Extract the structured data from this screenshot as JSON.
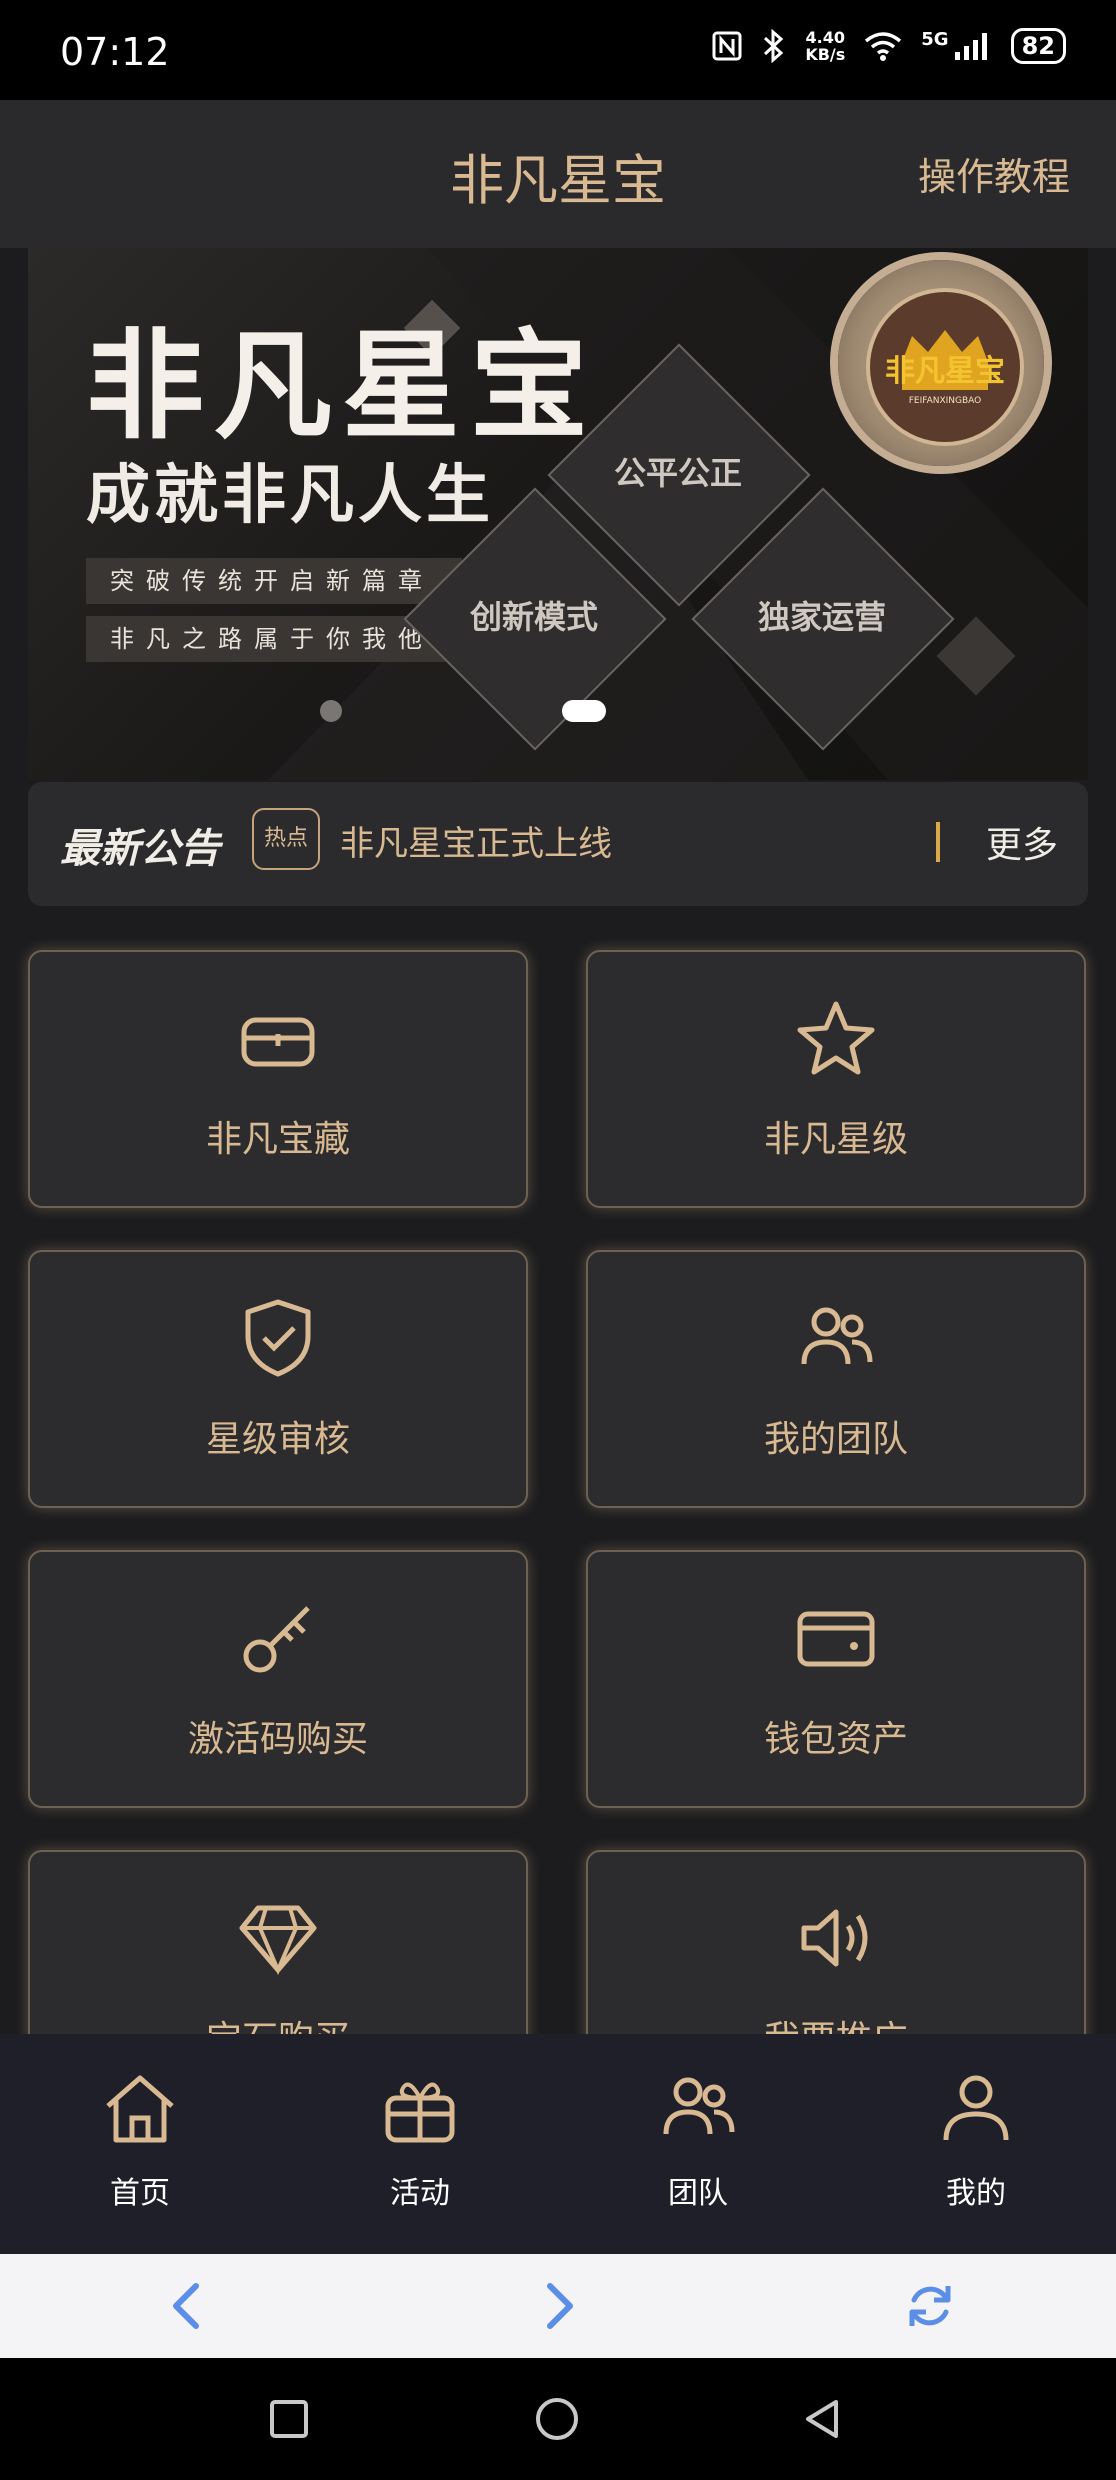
{
  "status_bar": {
    "time": "07:12",
    "net_speed_value": "4.40",
    "net_speed_unit": "KB/s",
    "network": "5G",
    "battery": "82"
  },
  "header": {
    "title": "非凡星宝",
    "tutorial_label": "操作教程"
  },
  "banner": {
    "title": "非凡星宝",
    "subtitle": "成就非凡人生",
    "tags": [
      "突破传统开启新篇章",
      "非凡之路属于你我他"
    ],
    "diamonds": [
      "公平公正",
      "创新模式",
      "独家运营"
    ],
    "seal_text": "非凡星宝",
    "seal_subtext": "FEIFANXINGBAO",
    "active_slide": 2,
    "slide_count": 2
  },
  "notice": {
    "heading": "最新公告",
    "badge": "热点",
    "text": "非凡星宝正式上线",
    "more_label": "更多"
  },
  "tiles": [
    {
      "label": "非凡宝藏",
      "icon": "treasure-box-icon"
    },
    {
      "label": "非凡星级",
      "icon": "star-icon"
    },
    {
      "label": "星级审核",
      "icon": "shield-check-icon"
    },
    {
      "label": "我的团队",
      "icon": "team-icon"
    },
    {
      "label": "激活码购买",
      "icon": "key-icon"
    },
    {
      "label": "钱包资产",
      "icon": "wallet-icon"
    },
    {
      "label": "宝石购买",
      "icon": "gem-icon"
    },
    {
      "label": "我要推广",
      "icon": "speaker-icon"
    }
  ],
  "bottom_nav": [
    {
      "label": "首页",
      "icon": "home-icon"
    },
    {
      "label": "活动",
      "icon": "gift-icon"
    },
    {
      "label": "团队",
      "icon": "team-icon"
    },
    {
      "label": "我的",
      "icon": "user-icon"
    }
  ],
  "colors": {
    "accent_gold": "#d9b992",
    "tile_bg": "#2c2c2e",
    "page_bg": "#1c1c1e",
    "browser_icon": "#5b8ee6"
  }
}
